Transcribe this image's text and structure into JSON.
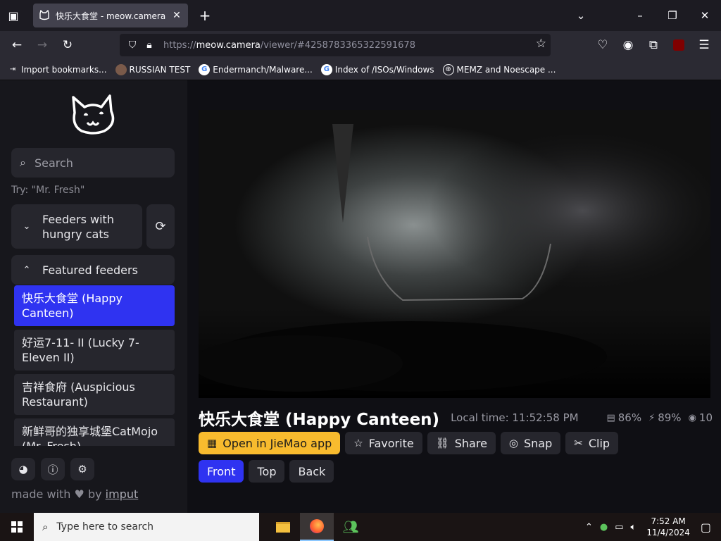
{
  "browser": {
    "tab_title": "快乐大食堂 - meow.camera",
    "url_scheme": "https://",
    "url_host": "meow.camera",
    "url_path": "/viewer/#4258783365322591678",
    "bookmarks": [
      {
        "label": "Import bookmarks...",
        "icon": "import-icon"
      },
      {
        "label": "RUSSIAN TEST",
        "icon": "site-icon"
      },
      {
        "label": "Endermanch/Malware...",
        "icon": "google-icon"
      },
      {
        "label": "Index of /ISOs/Windows",
        "icon": "google-icon"
      },
      {
        "label": "MEMZ and Noescape ...",
        "icon": "globe-icon"
      }
    ]
  },
  "sidebar": {
    "search_placeholder": "Search",
    "try_text": "Try: \"Mr. Fresh\"",
    "hungry_section": "Feeders with hungry cats",
    "featured_section": "Featured feeders",
    "feeders": [
      "快乐大食堂 (Happy Canteen)",
      "好运7-11- II (Lucky 7-Eleven II)",
      "吉祥食府 (Auspicious Restaurant)",
      "新鲜哥的独享城堡CatMojo (Mr. Fresh)"
    ],
    "made_with": "made with",
    "by": "by",
    "author": "imput"
  },
  "main": {
    "title": "快乐大食堂 (Happy Canteen)",
    "local_time": "Local time: 11:52:58 PM",
    "stats": {
      "food": "86%",
      "battery": "89%",
      "viewers": "10"
    },
    "actions": [
      "Open in JieMao app",
      "Favorite",
      "Share",
      "Snap",
      "Clip"
    ],
    "views": [
      "Front",
      "Top",
      "Back"
    ]
  },
  "taskbar": {
    "search_placeholder": "Type here to search",
    "time": "7:52 AM",
    "date": "11/4/2024"
  }
}
